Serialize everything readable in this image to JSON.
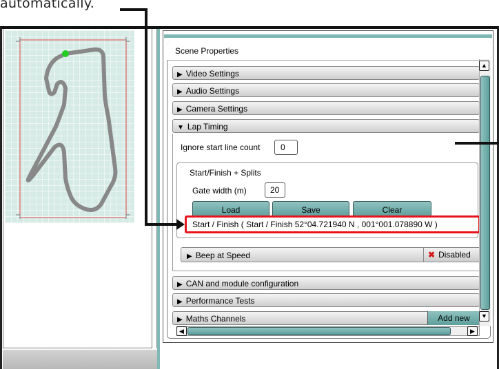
{
  "caption": "automatically.",
  "panel": {
    "title": "Scene Properties",
    "sections": {
      "video": "Video Settings",
      "audio": "Audio Settings",
      "camera": "Camera Settings",
      "lap_timing": "Lap Timing",
      "can": "CAN and module configuration",
      "performance": "Performance Tests",
      "maths": "Maths Channels"
    },
    "lap_timing": {
      "ignore_label": "Ignore start line count",
      "ignore_value": "0",
      "splits_label": "Start/Finish + Splits",
      "gate_label": "Gate width (m)",
      "gate_value": "20",
      "load": "Load",
      "save": "Save",
      "clear": "Clear",
      "start_finish_entry": "Start / Finish ( Start / Finish 52°04.721940 N , 001°001.078890 W )",
      "beep": "Beep at Speed",
      "beep_status": "Disabled"
    },
    "add_new": "Add new"
  },
  "icons": {
    "collapsed": "triangle-right-icon",
    "expanded": "triangle-down-icon",
    "disabled": "x-icon",
    "scroll_up": "arrow-up-icon",
    "scroll_down": "arrow-down-icon",
    "scroll_left": "arrow-left-icon",
    "scroll_right": "arrow-right-icon"
  },
  "colors": {
    "accent": "#7fb8b5",
    "highlight": "#e8141c",
    "track": "#888888",
    "map_border": "#e04848",
    "start_marker": "#22cc22"
  }
}
